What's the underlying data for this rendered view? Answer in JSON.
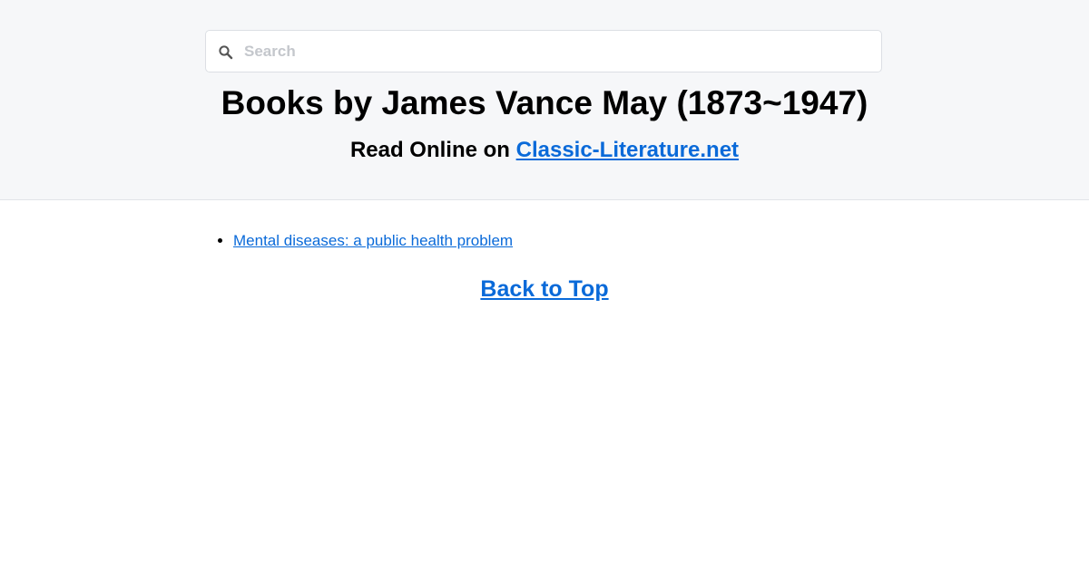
{
  "search": {
    "placeholder": "Search",
    "value": ""
  },
  "header": {
    "title": "Books by James Vance May (1873~1947)",
    "subtitle_prefix": "Read Online on",
    "site_link": "Classic-Literature.net"
  },
  "books": [
    {
      "title": "Mental diseases: a public health problem"
    }
  ],
  "footer": {
    "back_to_top": "Back to Top"
  },
  "colors": {
    "link": "#0a6ad9",
    "header_bg": "#f6f7f9"
  }
}
